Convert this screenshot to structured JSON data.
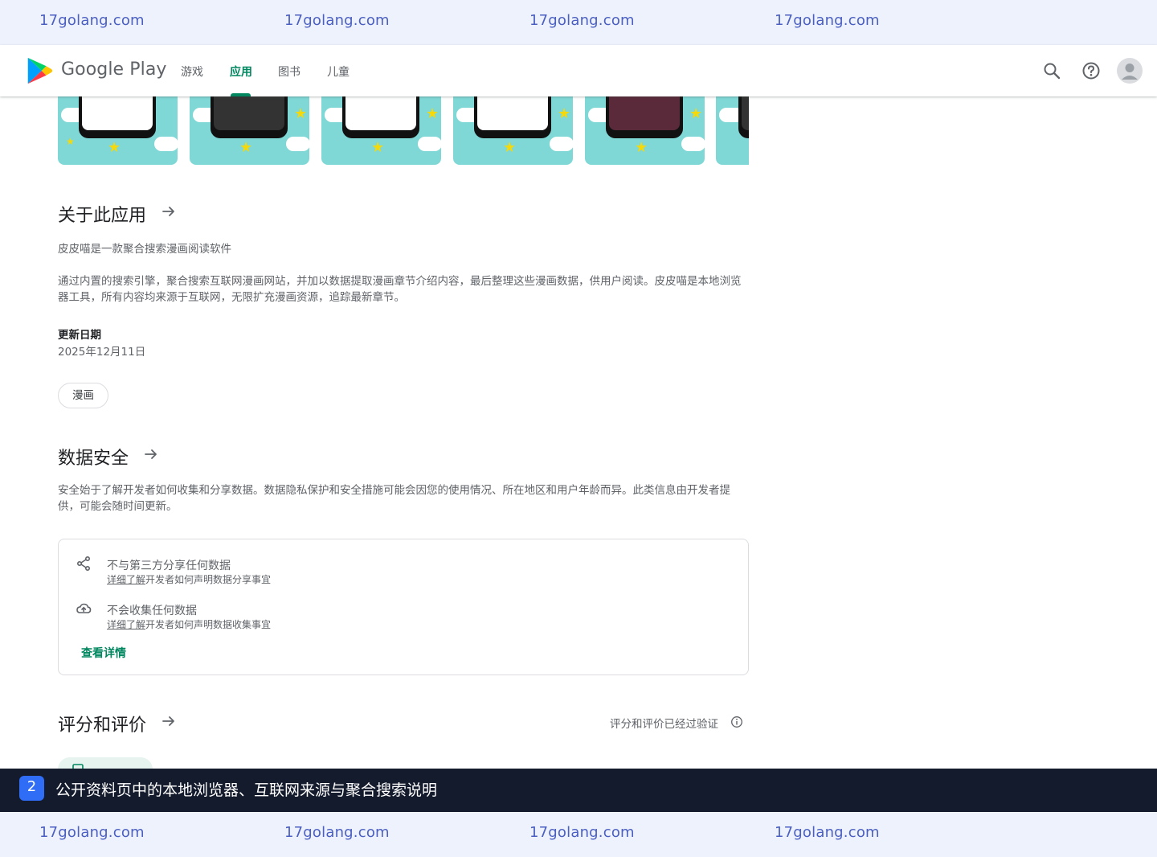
{
  "watermark": {
    "top": [
      "17golang.com",
      "17golang.com",
      "17golang.com",
      "17golang.com"
    ],
    "bottom": [
      "17golang.com",
      "17golang.com",
      "17golang.com",
      "17golang.com"
    ]
  },
  "header": {
    "brand": "Google Play",
    "nav": [
      "游戏",
      "应用",
      "图书",
      "儿童"
    ],
    "active_nav": "应用",
    "icons": [
      "search-icon",
      "help-icon",
      "account-avatar"
    ]
  },
  "about": {
    "title": "关于此应用",
    "para1": "皮皮喵是一款聚合搜索漫画阅读软件",
    "para2": "通过内置的搜索引擎，聚合搜索互联网漫画网站，并加以数据提取漫画章节介绍内容，最后整理这些漫画数据，供用户阅读。皮皮喵是本地浏览器工具，所有内容均来源于互联网，无限扩充漫画资源，追踪最新章节。",
    "updated_label": "更新日期",
    "updated_value": "2025年12月11日",
    "tag": "漫画"
  },
  "safety": {
    "title": "数据安全",
    "desc": "安全始于了解开发者如何收集和分享数据。数据隐私保护和安全措施可能会因您的使用情况、所在地区和用户年龄而异。此类信息由开发者提供，可能会随时间更新。",
    "items": [
      {
        "icon": "share-icon",
        "main": "不与第三方分享任何数据",
        "link": "详细了解",
        "sub": "开发者如何声明数据分享事宜"
      },
      {
        "icon": "cloud-upload-icon",
        "main": "不会收集任何数据",
        "link": "详细了解",
        "sub": "开发者如何声明数据收集事宜"
      }
    ],
    "more": "查看详情"
  },
  "ratings": {
    "title": "评分和评价",
    "verified": "评分和评价已经过验证"
  },
  "caption": {
    "badge": "2",
    "text": "公开资料页中的本地浏览器、互联网来源与聚合搜索说明"
  },
  "colors": {
    "accent": "#01875f",
    "caption_bg": "#141b2d",
    "badge": "#2f6df6",
    "watermark_bg": "#eef2fd"
  }
}
